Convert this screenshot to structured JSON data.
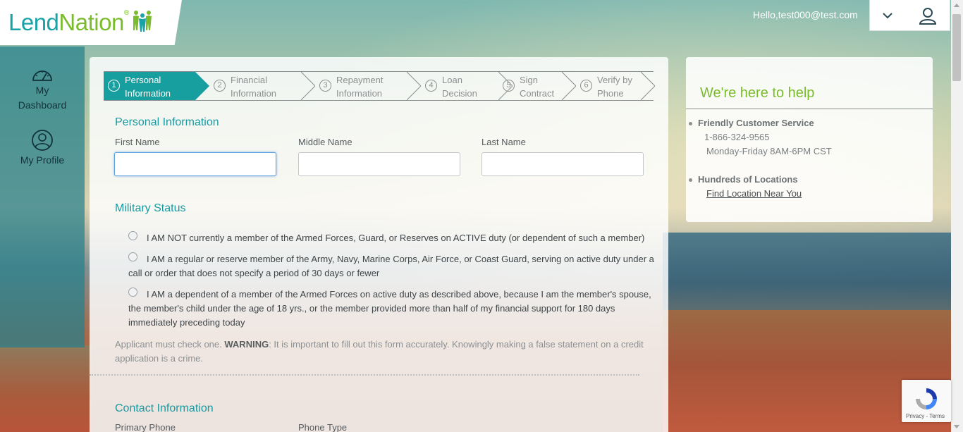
{
  "brand": {
    "name_part1": "Lend",
    "name_part2": "Nation",
    "registered": "®"
  },
  "header": {
    "greeting": "Hello,test000@test.com"
  },
  "sidebar": {
    "items": [
      {
        "label_line1": "My",
        "label_line2": "Dashboard",
        "icon": "gauge-icon"
      },
      {
        "label_line1": "My Profile",
        "icon": "profile-icon"
      }
    ]
  },
  "steps": [
    {
      "num": "1",
      "line1": "Personal",
      "line2": "Information",
      "active": true
    },
    {
      "num": "2",
      "line1": "Financial",
      "line2": "Information",
      "active": false
    },
    {
      "num": "3",
      "line1": "Repayment",
      "line2": "Information",
      "active": false
    },
    {
      "num": "4",
      "line1": "Loan",
      "line2": "Decision",
      "active": false
    },
    {
      "num": "5",
      "line1": "Sign",
      "line2": "Contract",
      "active": false
    },
    {
      "num": "6",
      "line1": "Verify by",
      "line2": "Phone",
      "active": false
    }
  ],
  "personal": {
    "title": "Personal Information",
    "first_name_label": "First Name",
    "middle_name_label": "Middle Name",
    "last_name_label": "Last Name",
    "first_name_value": "",
    "middle_name_value": "",
    "last_name_value": ""
  },
  "military": {
    "title": "Military Status",
    "options": [
      "I AM  NOT currently a member of the Armed Forces, Guard, or  Reserves on ACTIVE duty (or dependent of such a member)",
      "I AM a regular or reserve member of the Army,  Navy,  Marine Corps, Air Force, or Coast Guard, serving on active duty under a call or order that does not specify a period of 30 days or fewer",
      "I AM a dependent of a member of the Armed  Forces on active duty as described above, because  I am the member's spouse, the member's child under the age of 18 yrs., or the member provided more than half of my financial support for 180 days immediately preceding today"
    ],
    "warning_prefix": "Applicant must check one. ",
    "warning_label": "WARNING",
    "warning_text": ":  It is important to fill out this form accurately.  Knowingly making a false statement on a credit application is a crime."
  },
  "contact": {
    "title": "Contact Information",
    "primary_phone_label": "Primary Phone",
    "phone_type_label": "Phone Type"
  },
  "help": {
    "title": "We're here to help",
    "service_title": "Friendly Customer Service",
    "phone": "1-866-324-9565",
    "hours": "Monday-Friday 8AM-6PM CST",
    "locations_title": "Hundreds of Locations",
    "locations_link": "Find  Location  Near You"
  },
  "recaptcha": {
    "text": "Privacy - Terms"
  },
  "colors": {
    "teal": "#179e9f",
    "green": "#7bbb2e"
  }
}
